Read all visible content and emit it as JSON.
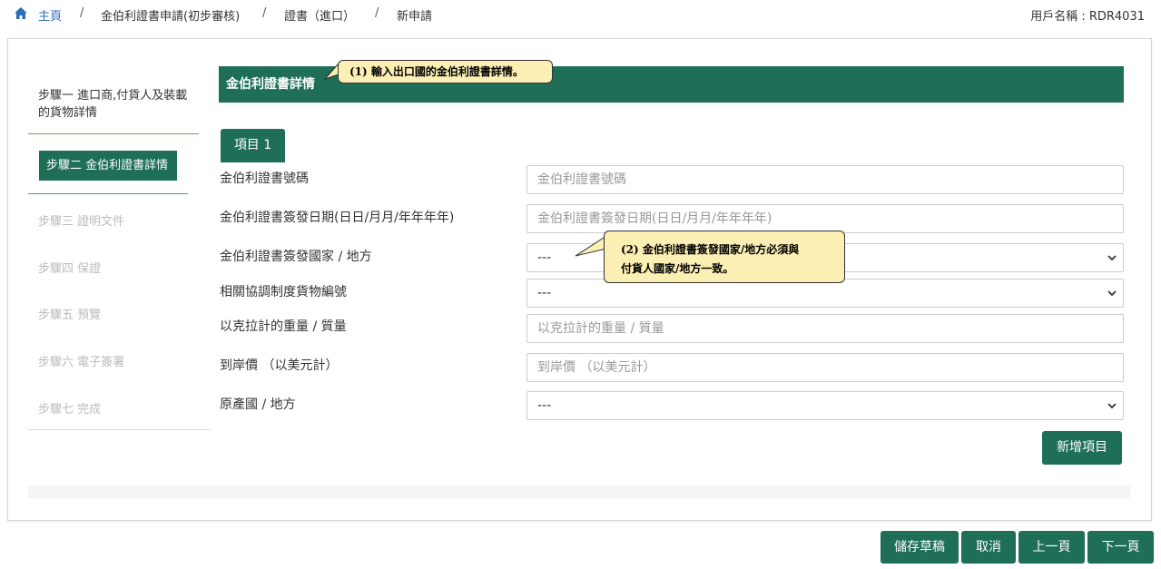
{
  "breadcrumb": {
    "home": "主頁",
    "items": [
      "金伯利證書申請(初步審核)",
      "證書（進口）",
      "新申請"
    ],
    "separator": "/"
  },
  "user": "用戶名稱 : RDR4031",
  "steps": [
    {
      "label": "步驟一 進口商,付貨人及裝載的貨物詳情",
      "state": "done"
    },
    {
      "label": "步驟二 金伯利證書詳情",
      "state": "active"
    },
    {
      "label": "步驟三 證明文件",
      "state": "pending"
    },
    {
      "label": "步驟四 保證",
      "state": "pending"
    },
    {
      "label": "步驟五 預覽",
      "state": "pending"
    },
    {
      "label": "步驟六 電子簽署",
      "state": "pending"
    },
    {
      "label": "步驟七 完成",
      "state": "pending"
    }
  ],
  "section_title": "金伯利證書詳情",
  "callouts": {
    "c1": "(1) 輸入出口國的金伯利證書詳情。",
    "c2_line1": "(2) 金伯利證書簽發國家/地方必須與",
    "c2_line2": "付貨人國家/地方一致。"
  },
  "item_tab": "項目 1",
  "form": {
    "cert_no": {
      "label": "金伯利證書號碼",
      "placeholder": "金伯利證書號碼"
    },
    "issue_date": {
      "label": "金伯利證書簽發日期(日日/月月/年年年年)",
      "placeholder": "金伯利證書簽發日期(日日/月月/年年年年)"
    },
    "issue_country": {
      "label": "金伯利證書簽發國家 / 地方",
      "value": "---"
    },
    "hs_code": {
      "label": "相關協調制度貨物編號",
      "value": "---"
    },
    "weight": {
      "label": "以克拉計的重量 / 質量",
      "placeholder": "以克拉計的重量 / 質量"
    },
    "cif": {
      "label": "到岸價 （以美元計）",
      "placeholder": "到岸價 （以美元計）"
    },
    "origin": {
      "label": "原產國 / 地方",
      "value": "---"
    }
  },
  "buttons": {
    "add_item": "新增項目",
    "save_draft": "儲存草稿",
    "cancel": "取消",
    "prev": "上一頁",
    "next": "下一頁"
  },
  "colors": {
    "primary": "#1e6e58",
    "link": "#2a6ebb",
    "callout_bg": "#fcefb4"
  }
}
